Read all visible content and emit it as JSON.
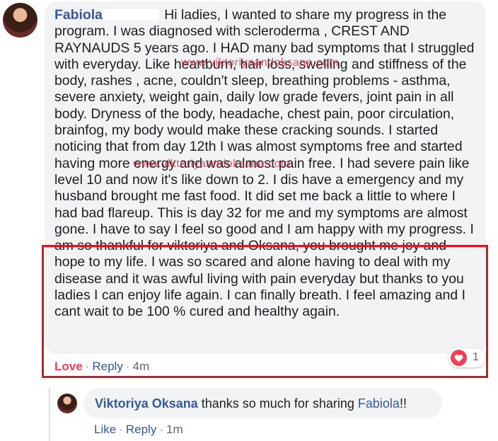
{
  "comment": {
    "author": "Fabiola",
    "text_1": "Hi ladies, I wanted to share my progress in the program. I was diagnosed with scleroderma , CREST AND RAYNAUDS 5 years ago. I HAD many bad symptoms that I struggled with everyday. Like heartburn, hair loss, swelling and stiffness of the body, rashes , acne, couldn't sleep, breathing problems - asthma, severe anxiety, weight gain, daily low grade fevers, joint pain in all body. Dryness of the body, headache, chest pain, poor circulation, brainfog, my body would make these cracking sounds. I started noticing that from day 12th I was almost symptoms free and started having more energy and was almost pain free. I had severe pain like level 10 and now it's like down to 2. I dis have a emergency and my husband brought me fast food. It did set me back a little to where I had bad flareup. This is day 32 for me and my symptoms are almost gone. I have to say I feel so good and I am happy with my progress. I am so thankful for viktoriya and Oksana, you brought me joy and hope to my life. I was so scared and alone having to deal with my disease and it was awful living with pain everyday but thanks to you ladies I can enjoy life again. I can finally breath. I feel amazing and I cant wait to be 100 % cured and healthy again.",
    "actions": {
      "love": "Love",
      "reply": "Reply",
      "time": "4m"
    },
    "reaction_count": "1",
    "reaction_icon": "heart-icon"
  },
  "watermark": "www.viktoriyaandoksana.com",
  "reply": {
    "author": "Viktoriya Oksana",
    "text": "thanks so much for sharing",
    "mention": "Fabiola",
    "suffix": "!!",
    "actions": {
      "like": "Like",
      "reply": "Reply",
      "time": "1m"
    }
  },
  "colors": {
    "link": "#385898",
    "love": "#f33e58",
    "highlight": "#e0141f",
    "watermark": "#e0243a",
    "bubble": "#f2f3f5"
  }
}
